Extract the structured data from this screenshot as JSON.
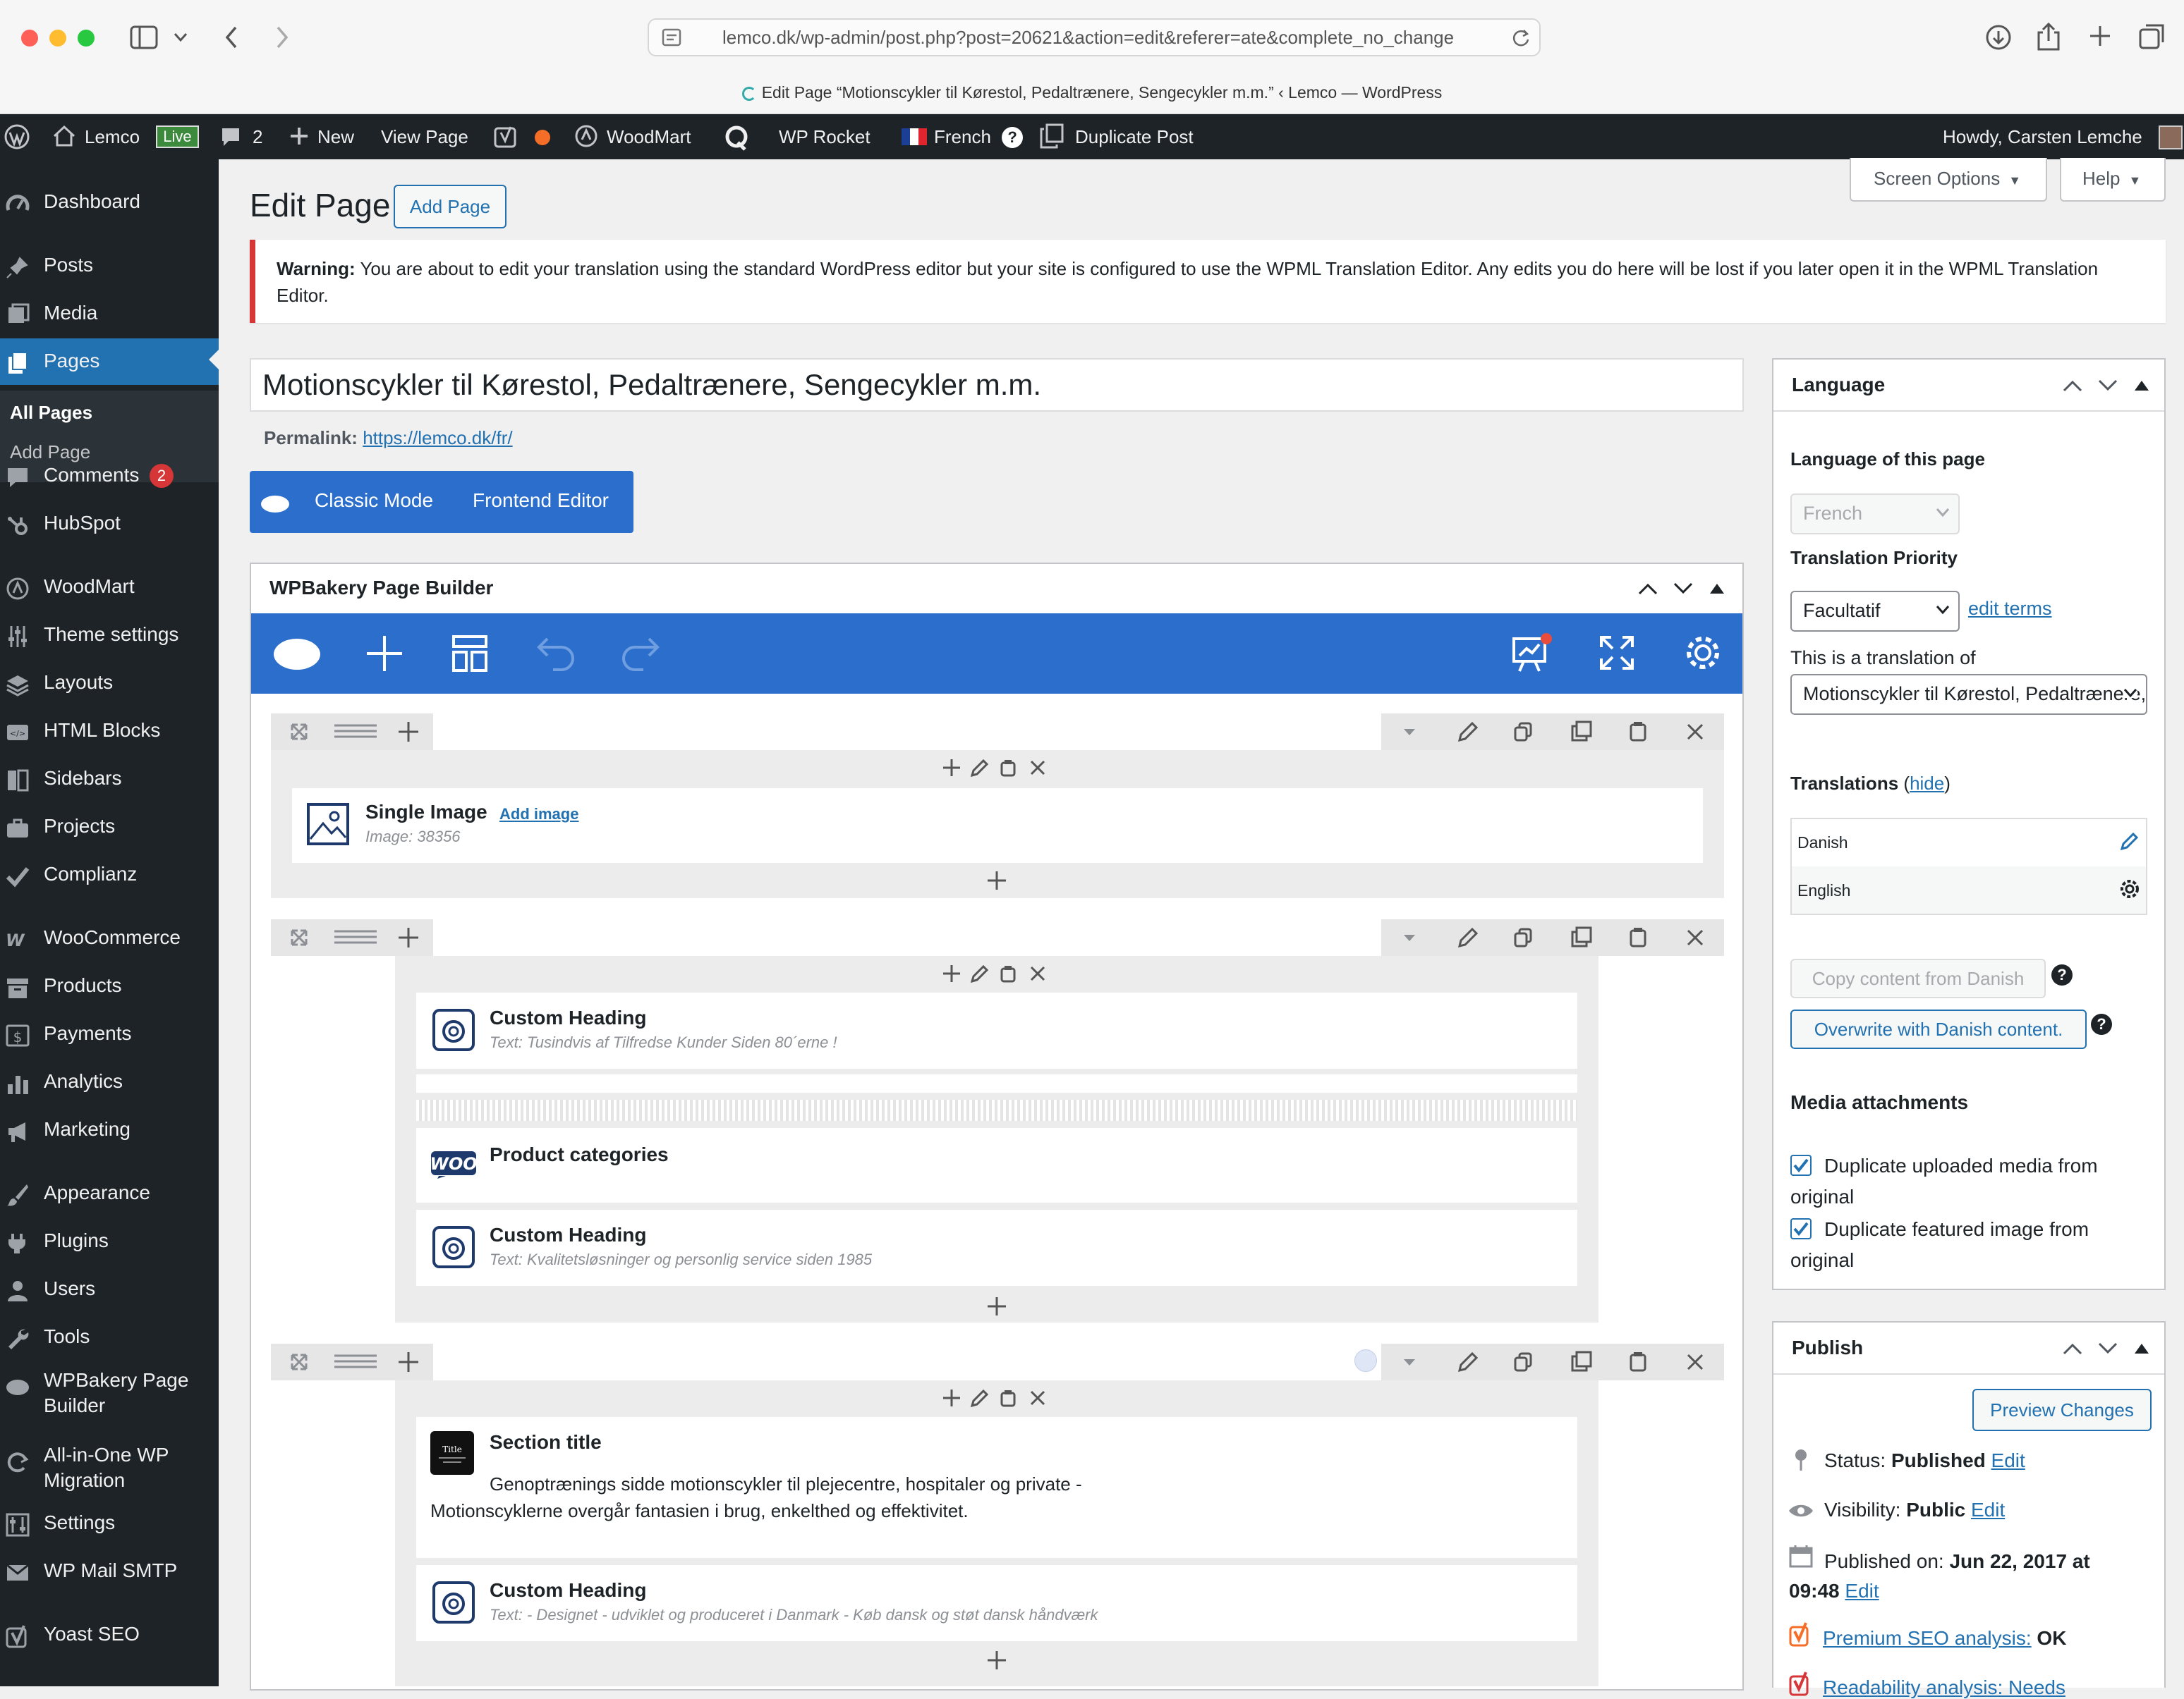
{
  "browser": {
    "url": "lemco.dk/wp-admin/post.php?post=20621&action=edit&referer=ate&complete_no_change",
    "tab_title": "Edit Page “Motionscykler til Kørestol, Pedaltrænere, Sengecykler m.m.” ‹ Lemco — WordPress"
  },
  "adminbar": {
    "site": "Lemco",
    "live_badge": "Live",
    "comments_count": "2",
    "new": "New",
    "view_page": "View Page",
    "woodmart": "WoodMart",
    "wp_rocket": "WP Rocket",
    "language": "French",
    "duplicate": "Duplicate Post",
    "howdy": "Howdy, Carsten Lemche"
  },
  "sidebar": {
    "items": [
      {
        "label": "Dashboard",
        "icon": "dashboard-icon"
      },
      {
        "label": "Posts",
        "icon": "pin-icon"
      },
      {
        "label": "Media",
        "icon": "media-icon"
      },
      {
        "label": "Pages",
        "icon": "pages-icon"
      },
      {
        "label": "Comments",
        "icon": "comment-icon",
        "badge": "2"
      },
      {
        "label": "HubSpot",
        "icon": "hubspot-icon"
      },
      {
        "label": "WoodMart",
        "icon": "woodmart-icon"
      },
      {
        "label": "Theme settings",
        "icon": "sliders-icon"
      },
      {
        "label": "Layouts",
        "icon": "layers-icon"
      },
      {
        "label": "HTML Blocks",
        "icon": "html-icon"
      },
      {
        "label": "Sidebars",
        "icon": "sidebar-icon"
      },
      {
        "label": "Projects",
        "icon": "briefcase-icon"
      },
      {
        "label": "Complianz",
        "icon": "check-icon"
      },
      {
        "label": "WooCommerce",
        "icon": "woo-icon"
      },
      {
        "label": "Products",
        "icon": "archive-icon"
      },
      {
        "label": "Payments",
        "icon": "dollar-icon"
      },
      {
        "label": "Analytics",
        "icon": "bar-chart-icon"
      },
      {
        "label": "Marketing",
        "icon": "megaphone-icon"
      },
      {
        "label": "Appearance",
        "icon": "brush-icon"
      },
      {
        "label": "Plugins",
        "icon": "plug-icon"
      },
      {
        "label": "Users",
        "icon": "user-icon"
      },
      {
        "label": "Tools",
        "icon": "wrench-icon"
      },
      {
        "label": "WPBakery Page Builder",
        "icon": "cloud-icon"
      },
      {
        "label": "All-in-One WP Migration",
        "icon": "migration-icon"
      },
      {
        "label": "Settings",
        "icon": "settings-icon"
      },
      {
        "label": "WP Mail SMTP",
        "icon": "mail-icon"
      },
      {
        "label": "Yoast SEO",
        "icon": "yoast-icon"
      }
    ],
    "submenu": [
      "All Pages",
      "Add Page"
    ]
  },
  "header": {
    "title": "Edit Page",
    "add_page": "Add Page",
    "screen_options": "Screen Options",
    "help": "Help"
  },
  "warning": {
    "strong": "Warning:",
    "text": " You are about to edit your translation using the standard WordPress editor but your site is configured to use the WPML Translation Editor. Any edits you do here will be lost if you later open it in the WPML Translation Editor."
  },
  "post": {
    "title": "Motionscykler til Kørestol, Pedaltrænere, Sengecykler m.m.",
    "permalink_label": "Permalink:",
    "permalink": "https://lemco.dk/fr/"
  },
  "modes": {
    "classic": "Classic Mode",
    "frontend": "Frontend Editor"
  },
  "builder": {
    "title": "WPBakery Page Builder",
    "row1": {
      "title": "Single Image",
      "action": "Add image",
      "desc": "Image: 38356"
    },
    "row2": [
      {
        "title": "Custom Heading",
        "desc": "Text: Tusindvis af Tilfredse Kunder Siden 80´erne !"
      },
      {
        "title": "Product categories",
        "logo": "WOO"
      },
      {
        "title": "Custom Heading",
        "desc": "Text: Kvalitetsløsninger og personlig service siden 1985"
      }
    ],
    "row3": [
      {
        "title": "Section title",
        "logo": "Title",
        "desc": "Genoptrænings sidde motionscykler til plejecentre, hospitaler og private - Motionscyklerne overgår fantasien i brug, enkelthed og effektivitet."
      },
      {
        "title": "Custom Heading",
        "desc": "Text: - Designet - udviklet og produceret i Danmark - Køb dansk og støt dansk håndværk"
      }
    ]
  },
  "language_box": {
    "title": "Language",
    "lang_label": "Language of this page",
    "lang_value": "French",
    "priority_label": "Translation Priority",
    "priority_value": "Facultatif",
    "edit_terms": "edit terms",
    "translation_of_label": "This is a translation of",
    "translation_of_value": "Motionscykler til Kørestol, Pedaltrænere,",
    "translations_label": "Translations",
    "hide": "hide",
    "translations": [
      "Danish",
      "English"
    ],
    "copy_btn": "Copy content from Danish",
    "overwrite_btn": "Overwrite with Danish content.",
    "media_label": "Media attachments",
    "dup_media": "Duplicate uploaded media from original",
    "dup_featured": "Duplicate featured image from original"
  },
  "publish": {
    "title": "Publish",
    "preview": "Preview Changes",
    "status_label": "Status:",
    "status": "Published",
    "visibility_label": "Visibility:",
    "visibility": "Public",
    "published_label": "Published on:",
    "published": "Jun 22, 2017 at 09:48",
    "edit": "Edit",
    "seo_label": "Premium SEO analysis:",
    "seo_value": "OK",
    "readability": "Readability analysis: Needs"
  },
  "colors": {
    "accent": "#2271b1",
    "builder_blue": "#2c6ecb",
    "admin_dark": "#1d2327",
    "warning_red": "#d63638"
  }
}
